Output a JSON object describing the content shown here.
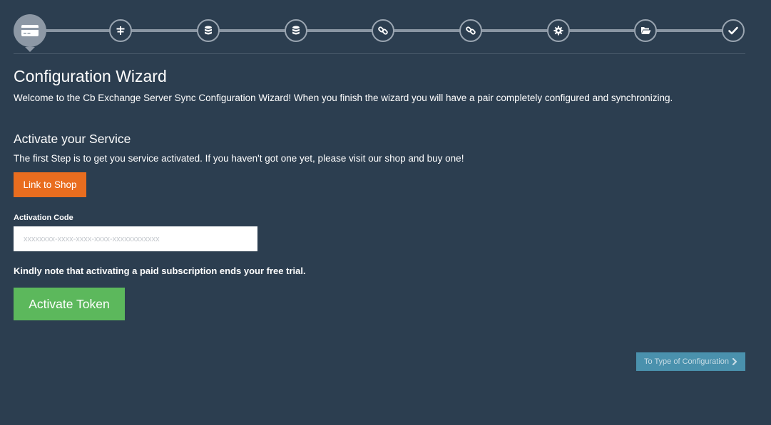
{
  "stepper": {
    "steps": [
      {
        "icon": "credit-card-icon",
        "active": true
      },
      {
        "icon": "signpost-icon",
        "active": false
      },
      {
        "icon": "database-icon",
        "active": false
      },
      {
        "icon": "database-icon",
        "active": false
      },
      {
        "icon": "link-icon",
        "active": false
      },
      {
        "icon": "link-icon",
        "active": false
      },
      {
        "icon": "gear-icon",
        "active": false
      },
      {
        "icon": "folder-open-icon",
        "active": false
      },
      {
        "icon": "check-icon",
        "active": false
      }
    ]
  },
  "page": {
    "title": "Configuration Wizard",
    "intro": "Welcome to the Cb Exchange Server Sync Configuration Wizard! When you finish the wizard you will have a pair completely configured and synchronizing."
  },
  "activate": {
    "heading": "Activate your Service",
    "text": "The first Step is to get you service activated. If you haven't got one yet, please visit our shop and buy one!",
    "shop_button": "Link to Shop",
    "code_label": "Activation Code",
    "code_value": "",
    "code_placeholder": "xxxxxxxx-xxxx-xxxx-xxxx-xxxxxxxxxxxx",
    "note": "Kindly note that activating a paid subscription ends your free trial.",
    "activate_button": "Activate Token"
  },
  "navigation": {
    "next_button": "To Type of Configuration",
    "next_icon": "chevron-right-icon"
  },
  "colors": {
    "background": "#2c3e50",
    "shop_button": "#e96d1f",
    "activate_button": "#5cb85c",
    "next_button": "#4a91ad",
    "step_active": "#8d98a5"
  }
}
